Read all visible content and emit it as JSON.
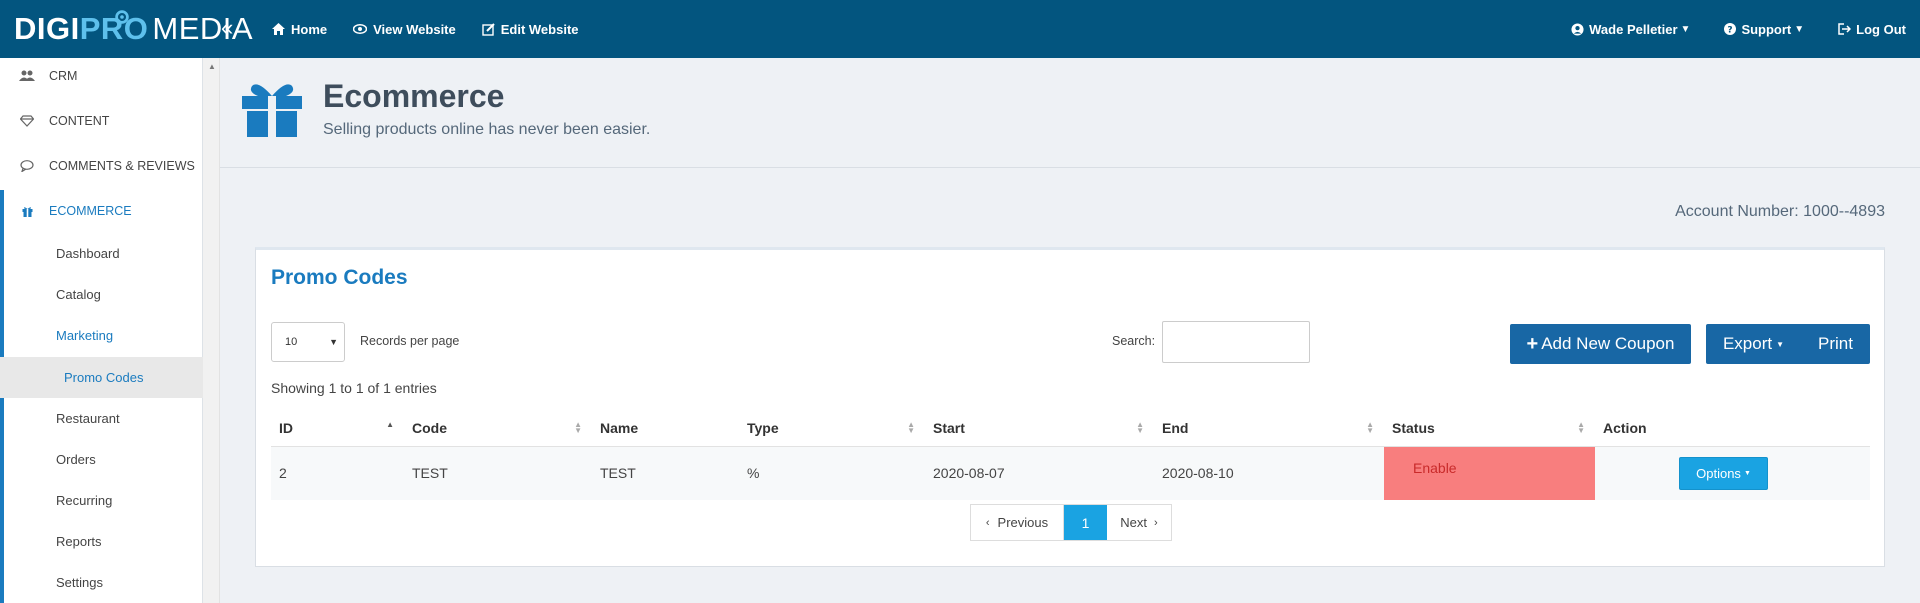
{
  "topbar": {
    "logo": {
      "part1": "DIGI",
      "part2": "PRO",
      "part3": "MEDIA"
    },
    "collapse_icon": "«",
    "nav": [
      {
        "label": "Home",
        "icon": "home-icon"
      },
      {
        "label": "View Website",
        "icon": "eye-icon"
      },
      {
        "label": "Edit Website",
        "icon": "edit-icon"
      }
    ],
    "user": "Wade Pelletier",
    "support": "Support",
    "logout": "Log Out"
  },
  "sidebar": {
    "items": [
      {
        "label": "CRM",
        "icon": "users-icon"
      },
      {
        "label": "CONTENT",
        "icon": "diamond-icon"
      },
      {
        "label": "COMMENTS & REVIEWS",
        "icon": "comment-icon"
      },
      {
        "label": "ECOMMERCE",
        "icon": "gift-icon"
      }
    ],
    "sub_items": [
      "Dashboard",
      "Catalog",
      "Marketing",
      "Promo Codes",
      "Restaurant",
      "Orders",
      "Recurring",
      "Reports",
      "Settings"
    ]
  },
  "header": {
    "title": "Ecommerce",
    "subtitle": "Selling products online has never been easier."
  },
  "account": "Account Number: 1000--4893",
  "panel": {
    "title": "Promo Codes",
    "records_per_page_value": "10",
    "records_per_page_label": "Records per page",
    "search_label": "Search:",
    "add_button": "Add New Coupon",
    "export_button": "Export",
    "print_button": "Print",
    "showing": "Showing 1 to 1 of 1 entries",
    "columns": [
      "ID",
      "Code",
      "Name",
      "Type",
      "Start",
      "End",
      "Status",
      "Action"
    ],
    "rows": [
      {
        "id": "2",
        "code": "TEST",
        "name": "TEST",
        "type": "%",
        "start": "2020-08-07",
        "end": "2020-08-10",
        "status": "Enable",
        "action": "Options"
      }
    ],
    "pager": {
      "previous": "Previous",
      "page": "1",
      "next": "Next"
    }
  },
  "colors": {
    "topbar": "#03557f",
    "accent": "#1a7bbf",
    "button_dark": "#1867a5",
    "button_light": "#1aa3e2",
    "status_bg": "#f87e7e"
  }
}
